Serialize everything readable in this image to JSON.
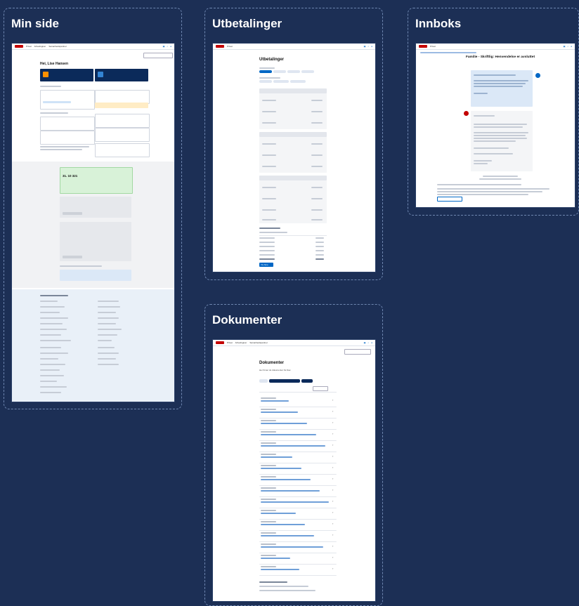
{
  "frames": {
    "min_side": {
      "title": "Min side"
    },
    "utbetalinger": {
      "title": "Utbetalinger"
    },
    "innboks": {
      "title": "Innboks"
    },
    "dokumenter": {
      "title": "Dokumenter"
    }
  },
  "min_side": {
    "nav": [
      "Privat",
      "Arbeidsgiver",
      "Samarbeidspartner"
    ],
    "greeting": "Hei, Lise Hansen",
    "saldo_amount": "31. 10 321"
  },
  "utbetalinger": {
    "heading": "Utbetalinger",
    "next_button": "Vis flere"
  },
  "innboks": {
    "heading": "Familie - Skriftlig: Henvendelse er avsluttet"
  },
  "dokumenter": {
    "heading": "Dokumenter",
    "intro": "Her finner du dokumenter fra Nav."
  },
  "colors": {
    "background": "#1c2f55",
    "nav_red": "#c30000",
    "link_blue": "#0067c5",
    "dark_card": "#0b2a5a",
    "alert_orange": "#ff9100",
    "success_green": "#d8f2d8"
  }
}
